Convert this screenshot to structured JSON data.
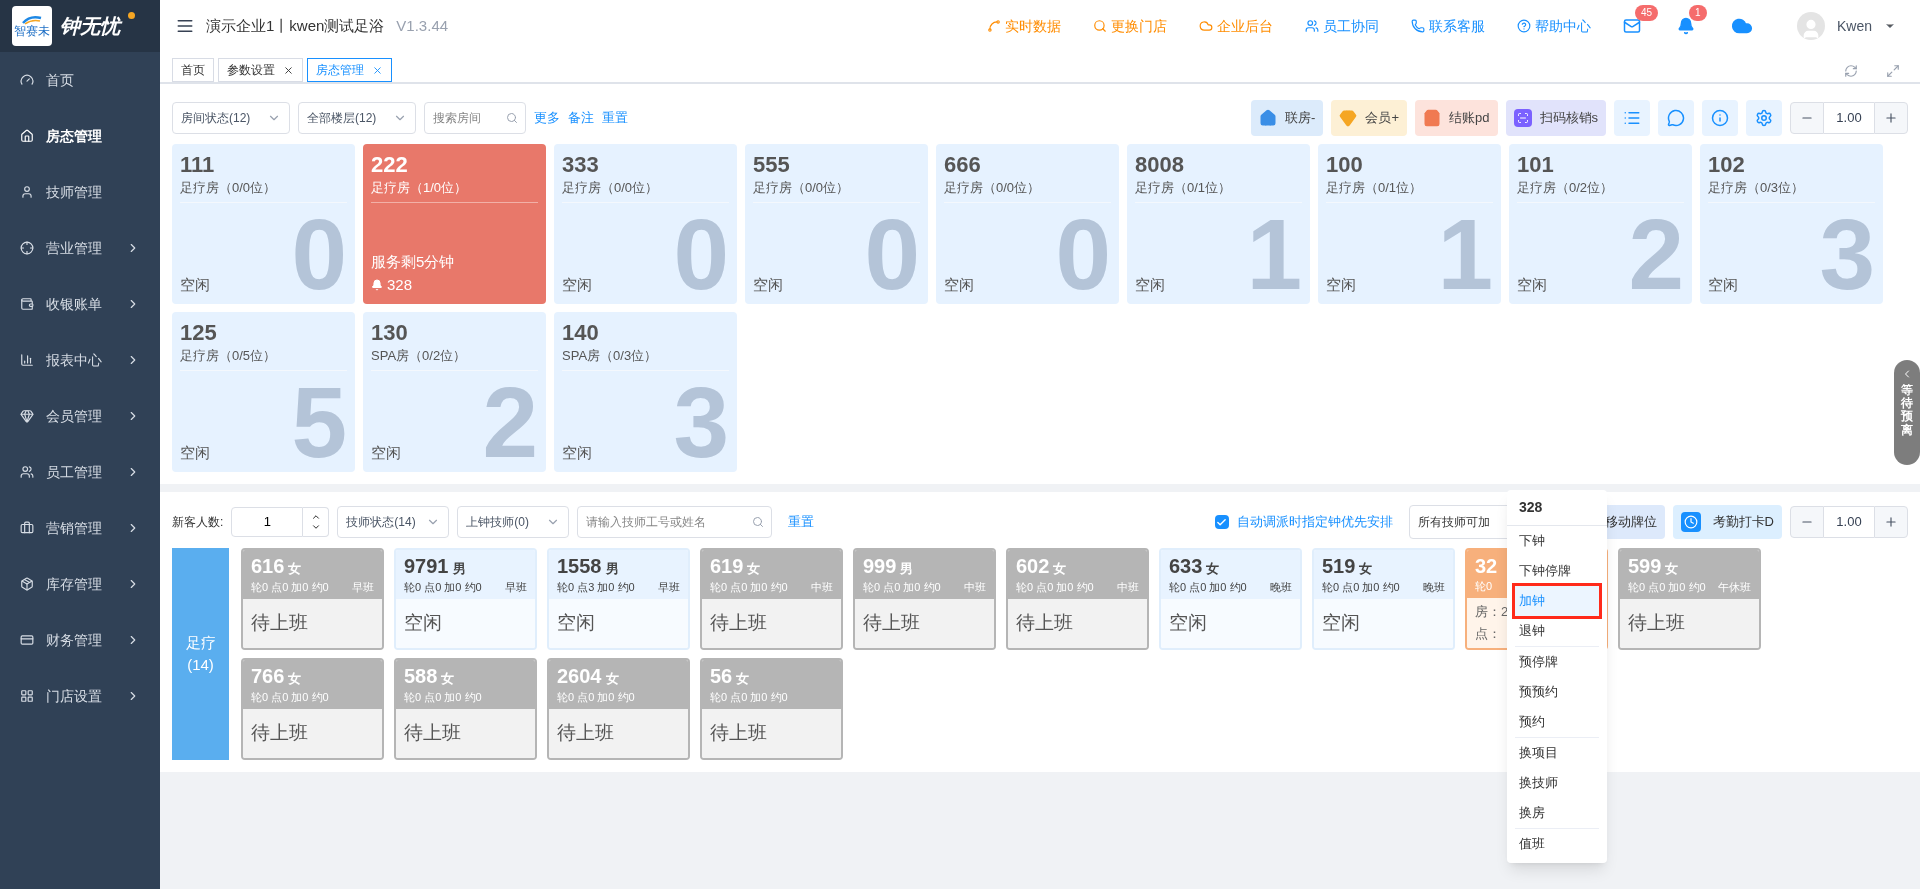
{
  "brand": {
    "name": "钟无忧",
    "sub": "智赛未"
  },
  "header": {
    "title": "演示企业1丨kwen测试足浴",
    "version": "V1.3.44",
    "links": [
      {
        "label": "实时数据",
        "color": "#ff8c00"
      },
      {
        "label": "更换门店",
        "color": "#ff8c00"
      },
      {
        "label": "企业后台",
        "color": "#ff8c00"
      },
      {
        "label": "员工协同",
        "color": "#1890ff"
      },
      {
        "label": "联系客服",
        "color": "#1890ff"
      },
      {
        "label": "帮助中心",
        "color": "#1890ff"
      }
    ],
    "mail_badge": "45",
    "bell_badge": "1",
    "user": "Kwen"
  },
  "tabs": [
    {
      "label": "首页",
      "closable": false,
      "selected": false
    },
    {
      "label": "参数设置",
      "closable": true,
      "selected": false
    },
    {
      "label": "房态管理",
      "closable": true,
      "selected": true
    }
  ],
  "sidebar": {
    "items": [
      {
        "label": "首页",
        "selected": false,
        "expandable": false
      },
      {
        "label": "房态管理",
        "selected": true,
        "expandable": false
      },
      {
        "label": "技师管理",
        "selected": false,
        "expandable": false
      },
      {
        "label": "营业管理",
        "selected": false,
        "expandable": true
      },
      {
        "label": "收银账单",
        "selected": false,
        "expandable": true
      },
      {
        "label": "报表中心",
        "selected": false,
        "expandable": true
      },
      {
        "label": "会员管理",
        "selected": false,
        "expandable": true
      },
      {
        "label": "员工管理",
        "selected": false,
        "expandable": true
      },
      {
        "label": "营销管理",
        "selected": false,
        "expandable": true
      },
      {
        "label": "库存管理",
        "selected": false,
        "expandable": true
      },
      {
        "label": "财务管理",
        "selected": false,
        "expandable": true
      },
      {
        "label": "门店设置",
        "selected": false,
        "expandable": true
      }
    ]
  },
  "room_toolbar": {
    "filters": [
      "房间状态(12)",
      "全部楼层(12)"
    ],
    "search": {
      "placeholder": "搜索房间"
    },
    "links": [
      "更多",
      "备注",
      "重置"
    ],
    "actions": [
      {
        "label": "联房-",
        "color": "#3a8ee6"
      },
      {
        "label": "会员+",
        "color": "#f5a623"
      },
      {
        "label": "结账pd",
        "color": "#f07a52"
      },
      {
        "label": "扫码核销s",
        "color": "#7b61ff"
      }
    ],
    "zoom": "1.00"
  },
  "rooms": [
    {
      "number": "111",
      "type": "足疗房（0/0位）",
      "status": "空闲",
      "count": "0",
      "kind": "idle"
    },
    {
      "number": "222",
      "type": "足疗房（1/0位）",
      "note": "服务剩5分钟",
      "tech": "328",
      "kind": "busy"
    },
    {
      "number": "333",
      "type": "足疗房（0/0位）",
      "status": "空闲",
      "count": "0",
      "kind": "idle"
    },
    {
      "number": "555",
      "type": "足疗房（0/0位）",
      "status": "空闲",
      "count": "0",
      "kind": "idle"
    },
    {
      "number": "666",
      "type": "足疗房（0/0位）",
      "status": "空闲",
      "count": "0",
      "kind": "idle"
    },
    {
      "number": "8008",
      "type": "足疗房（0/1位）",
      "status": "空闲",
      "count": "1",
      "kind": "idle"
    },
    {
      "number": "100",
      "type": "足疗房（0/1位）",
      "status": "空闲",
      "count": "1",
      "kind": "idle"
    },
    {
      "number": "101",
      "type": "足疗房（0/2位）",
      "status": "空闲",
      "count": "2",
      "kind": "idle"
    },
    {
      "number": "102",
      "type": "足疗房（0/3位）",
      "status": "空闲",
      "count": "3",
      "kind": "idle"
    },
    {
      "number": "125",
      "type": "足疗房（0/5位）",
      "status": "空闲",
      "count": "5",
      "kind": "idle"
    },
    {
      "number": "130",
      "type": "SPA房（0/2位）",
      "status": "空闲",
      "count": "2",
      "kind": "idle"
    },
    {
      "number": "140",
      "type": "SPA房（0/3位）",
      "status": "空闲",
      "count": "3",
      "kind": "idle"
    }
  ],
  "side_tab": "等待预离",
  "tech_toolbar": {
    "new_guests_label": "新客人数:",
    "new_guests": "1",
    "filters": [
      "技师状态(14)",
      "上钟技师(0)"
    ],
    "search": {
      "placeholder": "请输入技师工号或姓名"
    },
    "reset": "重置",
    "auto_dispatch": {
      "label": "自动调派时指定钟优先安排",
      "checked": true
    },
    "all_techs": "所有技师可加",
    "move": "移动牌位",
    "clock_in": "考勤打卡D",
    "zoom": "1.00"
  },
  "tech_groups": [
    {
      "name": "足疗",
      "count": "(14)",
      "techs": [
        {
          "number": "616",
          "gender": "女",
          "stats": "轮0 点0 加0 约0",
          "shift": "早班",
          "status": "待上班",
          "kind": "off"
        },
        {
          "number": "9791",
          "gender": "男",
          "stats": "轮0 点0 加0 约0",
          "shift": "早班",
          "status": "空闲",
          "kind": "idle"
        },
        {
          "number": "1558",
          "gender": "男",
          "stats": "轮0 点3 加0 约0",
          "shift": "早班",
          "status": "空闲",
          "kind": "idle"
        },
        {
          "number": "619",
          "gender": "女",
          "stats": "轮0 点0 加0 约0",
          "shift": "中班",
          "status": "待上班",
          "kind": "off"
        },
        {
          "number": "999",
          "gender": "男",
          "stats": "轮0 点0 加0 约0",
          "shift": "中班",
          "status": "待上班",
          "kind": "off"
        },
        {
          "number": "602",
          "gender": "女",
          "stats": "轮0 点0 加0 约0",
          "shift": "中班",
          "status": "待上班",
          "kind": "off"
        },
        {
          "number": "633",
          "gender": "女",
          "stats": "轮0 点0 加0 约0",
          "shift": "晚班",
          "status": "空闲",
          "kind": "idle"
        },
        {
          "number": "519",
          "gender": "女",
          "stats": "轮0 点0 加0 约0",
          "shift": "晚班",
          "status": "空闲",
          "kind": "idle"
        },
        {
          "number": "32",
          "stats": "轮0",
          "lines": [
            "房：2",
            "点："
          ],
          "kind": "busy"
        },
        {
          "number": "599",
          "gender": "女",
          "stats": "轮0 点0 加0 约0",
          "shift": "午休班",
          "status": "待上班",
          "kind": "off"
        },
        {
          "number": "766",
          "gender": "女",
          "stats": "轮0 点0 加0 约0",
          "status": "待上班",
          "kind": "off"
        },
        {
          "number": "588",
          "gender": "女",
          "stats": "轮0 点0 加0 约0",
          "status": "待上班",
          "kind": "off"
        },
        {
          "number": "2604",
          "gender": "女",
          "stats": "轮0 点0 加0 约0",
          "status": "待上班",
          "kind": "off"
        },
        {
          "number": "56",
          "gender": "女",
          "stats": "轮0 点0 加0 约0",
          "status": "待上班",
          "kind": "off"
        }
      ]
    }
  ],
  "context_menu": {
    "title": "328",
    "groups": [
      [
        {
          "label": "下钟",
          "selected": false
        },
        {
          "label": "下钟停牌",
          "selected": false
        },
        {
          "label": "加钟",
          "selected": true
        },
        {
          "label": "退钟",
          "selected": false
        }
      ],
      [
        {
          "label": "预停牌",
          "selected": false
        },
        {
          "label": "预预约",
          "selected": false
        },
        {
          "label": "预约",
          "selected": false
        }
      ],
      [
        {
          "label": "换项目",
          "selected": false
        },
        {
          "label": "换技师",
          "selected": false
        },
        {
          "label": "换房",
          "selected": false
        }
      ],
      [
        {
          "label": "值班",
          "selected": false
        }
      ]
    ]
  }
}
